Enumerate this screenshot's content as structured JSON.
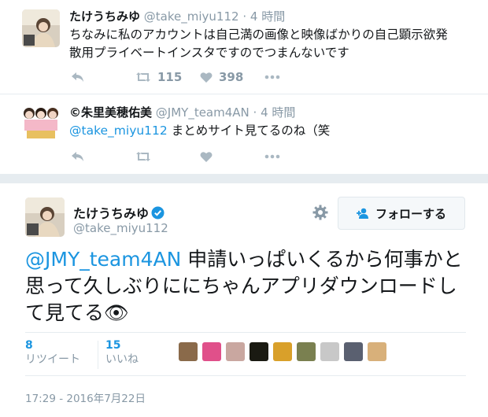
{
  "tweet1": {
    "name": "たけうちみゆ",
    "handle": "@take_miyu112",
    "separator": "·",
    "time": "4 時間",
    "text": "ちなみに私のアカウントは自己満の画像と映像ばかりの自己顕示欲発散用プライベートインスタですのでつまんないです",
    "retweets": "115",
    "likes": "398"
  },
  "tweet2": {
    "name": "©朱里美穂佑美",
    "handle": "@JMY_team4AN",
    "separator": "·",
    "time": "4 時間",
    "mention": "@take_miyu112",
    "text": " まとめサイト見てるのね（笑"
  },
  "main": {
    "name": "たけうちみゆ",
    "handle": "@take_miyu112",
    "follow_label": "フォローする",
    "mention": "@JMY_team4AN",
    "text": " 申請いっぱいくるから何事かと思って久しぶりににちゃんアプリダウンロードして見てる",
    "emoji": "👁",
    "retweet_count": "8",
    "retweet_label": "リツイート",
    "like_count": "15",
    "like_label": "いいね",
    "liker_colors": [
      "#8a6a4a",
      "#e0508a",
      "#c9a7a0",
      "#1a1a12",
      "#d9a02a",
      "#7a8050",
      "#c8c8c8",
      "#5a6070",
      "#d8b07a"
    ],
    "timestamp": "17:29 - 2016年7月22日"
  },
  "colors": {
    "link": "#1b95e0",
    "muted": "#8899a6",
    "icon": "#aab8c2",
    "divider": "#e6ecf0"
  },
  "icons": [
    "reply-icon",
    "retweet-icon",
    "heart-icon",
    "more-icon",
    "verified-icon",
    "gear-icon",
    "follow-user-icon"
  ]
}
